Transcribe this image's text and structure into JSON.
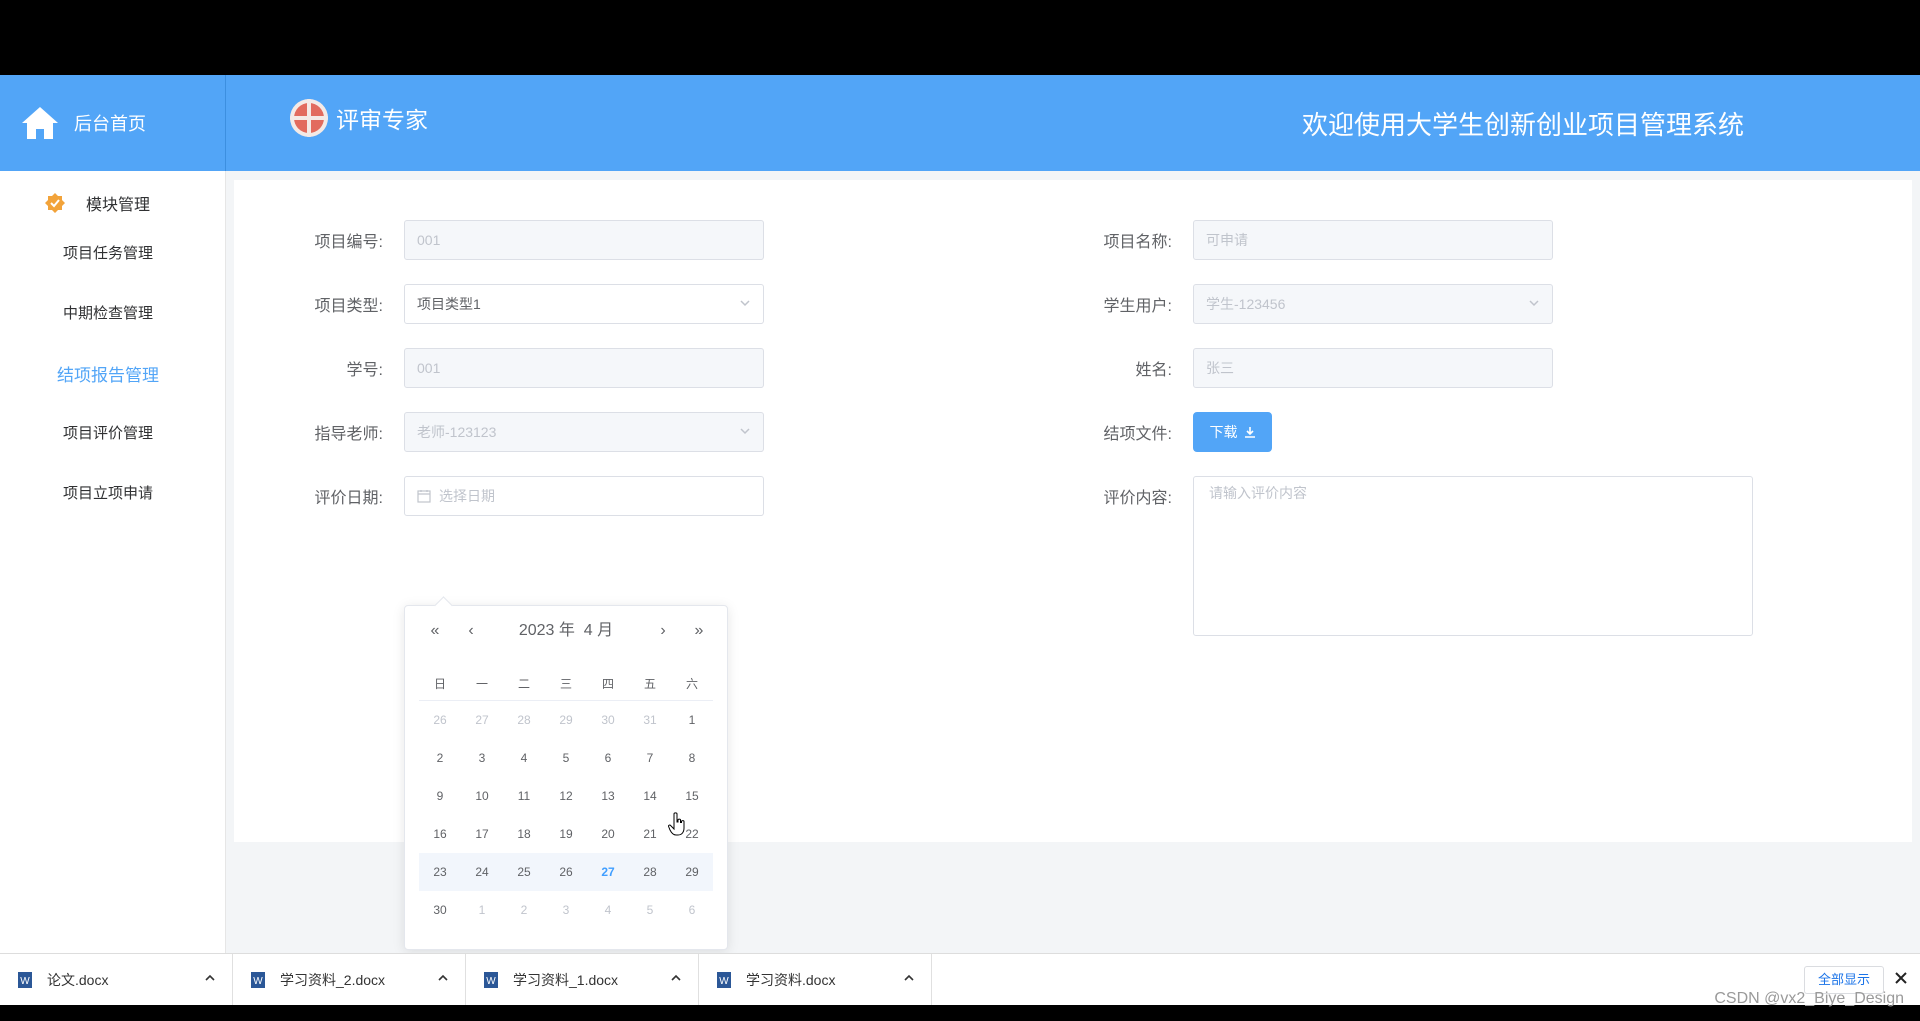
{
  "header": {
    "brand_label": "后台首页",
    "role_label": "评审专家",
    "system_title": "欢迎使用大学生创新创业项目管理系统",
    "colors": {
      "primary": "#52a5f7",
      "text": "#ffffff"
    }
  },
  "sidebar": {
    "group_label": "模块管理",
    "items": [
      {
        "label": "项目任务管理"
      },
      {
        "label": "中期检查管理"
      },
      {
        "label": "结项报告管理",
        "active": true
      },
      {
        "label": "项目评价管理"
      },
      {
        "label": "项目立项申请"
      }
    ]
  },
  "form": {
    "project_no": {
      "label": "项目编号:",
      "value": "001"
    },
    "project_name": {
      "label": "项目名称:",
      "value": "可申请"
    },
    "project_type": {
      "label": "项目类型:",
      "value": "项目类型1"
    },
    "student_user": {
      "label": "学生用户:",
      "value": "学生-123456"
    },
    "student_no": {
      "label": "学号:",
      "value": "001"
    },
    "name": {
      "label": "姓名:",
      "value": "张三"
    },
    "teacher": {
      "label": "指导老师:",
      "value": "老师-123123"
    },
    "final_file": {
      "label": "结项文件:",
      "button": "下载"
    },
    "eval_date": {
      "label": "评价日期:",
      "placeholder": "选择日期"
    },
    "eval_content": {
      "label": "评价内容:",
      "placeholder": "请输入评价内容"
    }
  },
  "date_picker": {
    "year_label": "2023 年",
    "month_label": "4 月",
    "weekdays": [
      "日",
      "一",
      "二",
      "三",
      "四",
      "五",
      "六"
    ],
    "weeks": [
      [
        "26",
        "27",
        "28",
        "29",
        "30",
        "31",
        "1"
      ],
      [
        "2",
        "3",
        "4",
        "5",
        "6",
        "7",
        "8"
      ],
      [
        "9",
        "10",
        "11",
        "12",
        "13",
        "14",
        "15"
      ],
      [
        "16",
        "17",
        "18",
        "19",
        "20",
        "21",
        "22"
      ],
      [
        "23",
        "24",
        "25",
        "26",
        "27",
        "28",
        "29"
      ],
      [
        "30",
        "1",
        "2",
        "3",
        "4",
        "5",
        "6"
      ]
    ],
    "today": "27",
    "highlight_week_index": 4
  },
  "downloads": {
    "items": [
      {
        "name": "论文.docx"
      },
      {
        "name": "学习资料_2.docx"
      },
      {
        "name": "学习资料_1.docx"
      },
      {
        "name": "学习资料.docx"
      }
    ],
    "show_all": "全部显示"
  },
  "watermark": "CSDN @vx2_Biye_Design"
}
